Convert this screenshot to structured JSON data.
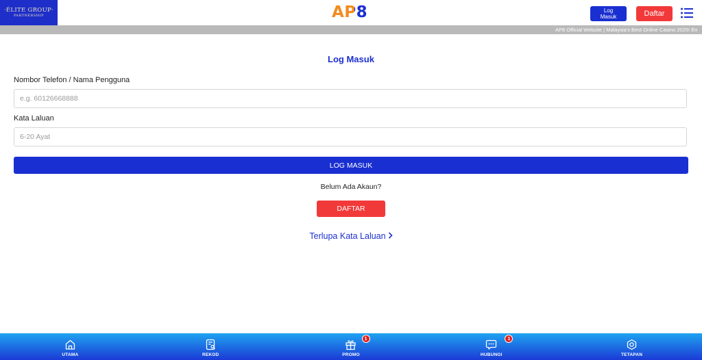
{
  "header": {
    "partner_logo_line1": "·ÉLITE GROUP·",
    "partner_logo_line2": "PARTNERSHIP",
    "brand_logo": "AP8",
    "login_button": "Log Masuk",
    "register_button": "Daftar",
    "menu_icon": "hamburger-menu-icon"
  },
  "marquee": {
    "text": "AP8 Official Website | Malaysia's Best Online Casino 2025! En"
  },
  "form": {
    "title": "Log Masuk",
    "username_label": "Nombor Telefon / Nama Pengguna",
    "username_placeholder": "e.g. 60126668888",
    "password_label": "Kata Laluan",
    "password_placeholder": "6-20 Ayat",
    "submit_button": "LOG MASUK",
    "no_account_text": "Belum Ada Akaun?",
    "register_button": "DAFTAR",
    "forgot_link": "Terlupa Kata Laluan"
  },
  "bottom_nav": {
    "items": [
      {
        "label": "UTAMA",
        "icon": "home-icon"
      },
      {
        "label": "REKOD",
        "icon": "record-icon"
      },
      {
        "label": "PROMO",
        "icon": "gift-icon",
        "badge": "1"
      },
      {
        "label": "HUBUNGI",
        "icon": "chat-icon",
        "badge": "1"
      },
      {
        "label": "TETAPAN",
        "icon": "settings-icon"
      }
    ]
  },
  "colors": {
    "primary_blue": "#1a2fd1",
    "accent_red": "#f2393a",
    "brand_orange": "#f28a1e"
  }
}
